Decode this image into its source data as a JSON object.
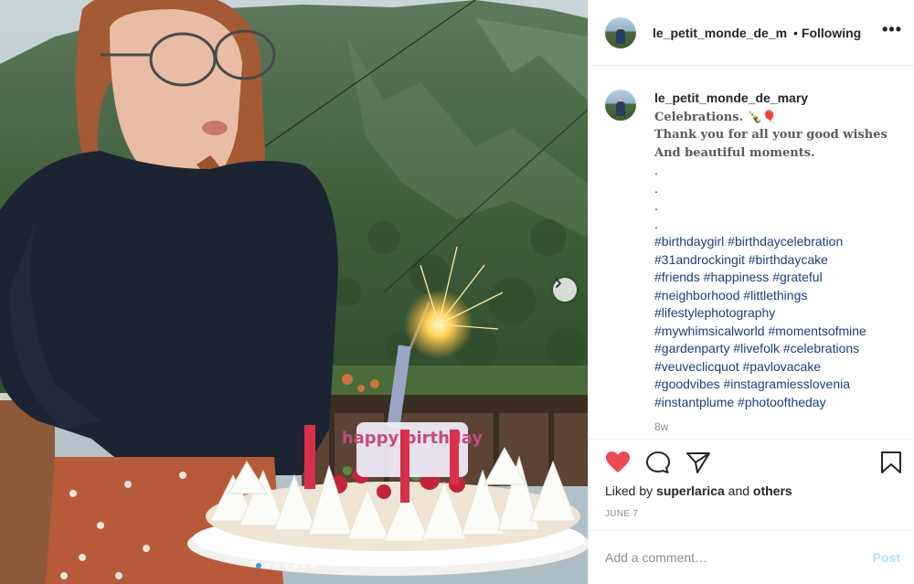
{
  "post": {
    "username": "le_petit_monde_de_mary",
    "header_username": "le_petit_monde_de_m",
    "separator": "•",
    "follow_status": "Following",
    "more_glyph": "•••"
  },
  "caption": {
    "username": "le_petit_monde_de_mary",
    "line1": "Celebrations. 🍾🎈",
    "line2": "Thank you for all your good wishes And beautiful moments.",
    "dots": [
      ".",
      ".",
      ".",
      "."
    ],
    "hashtags": [
      "#birthdaygirl #birthdaycelebration",
      "#31androckingit #birthdaycake",
      "#friends #happiness #grateful",
      "#neighborhood #littlethings",
      "#lifestylephotography",
      "#mywhimsicalworld #momentsofmine",
      "#gardenparty #livefolk #celebrations",
      "#veuveclicquot #pavlovacake",
      "#goodvibes #instagramiesslovenia",
      "#instantplume #photooftheday"
    ],
    "time_ago": "8w"
  },
  "engagement": {
    "liked_prefix": "Liked by ",
    "liked_user": "superlarica",
    "liked_and": " and ",
    "liked_others": "others",
    "date": "JUNE 7"
  },
  "comment_box": {
    "placeholder": "Add a comment…",
    "post_label": "Post"
  },
  "icons": {
    "heart": "heart-icon",
    "comment": "comment-icon",
    "share": "share-icon",
    "save": "bookmark-icon",
    "next": "chevron-right-icon"
  },
  "carousel": {
    "slides": 7,
    "active_index": 0
  },
  "colors": {
    "like_red": "#ed4956",
    "hashtag_blue": "#1c3f7c",
    "post_disabled": "#b2dffc",
    "active_dot": "#3897f0"
  },
  "cake_candle_text": "happy birthday"
}
